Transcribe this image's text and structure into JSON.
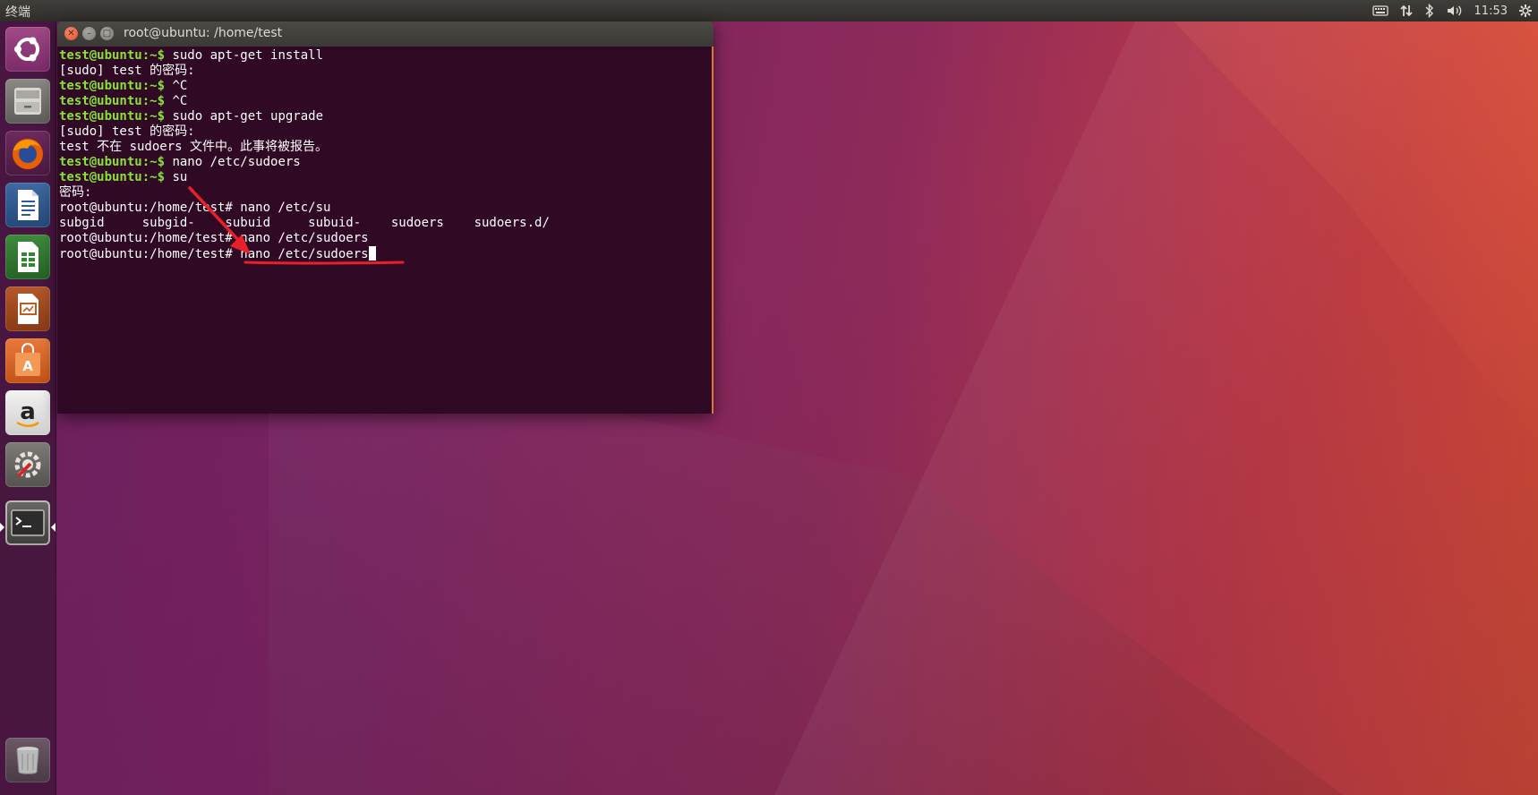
{
  "top_panel": {
    "app_title": "终端",
    "clock": "11:53",
    "indicator_icons": [
      "keyboard-icon",
      "network-icon",
      "bluetooth-icon",
      "volume-icon",
      "gear-icon"
    ]
  },
  "launcher": {
    "items": [
      {
        "name": "ubuntu-dash",
        "icon": "ubuntu-logo-icon"
      },
      {
        "name": "files",
        "icon": "file-cabinet-icon"
      },
      {
        "name": "firefox",
        "icon": "firefox-icon"
      },
      {
        "name": "writer",
        "icon": "document-icon"
      },
      {
        "name": "calc",
        "icon": "spreadsheet-icon"
      },
      {
        "name": "impress",
        "icon": "presentation-icon"
      },
      {
        "name": "software",
        "icon": "shopping-bag-icon"
      },
      {
        "name": "amazon",
        "icon": "amazon-icon"
      },
      {
        "name": "system-settings",
        "icon": "settings-wrench-icon"
      },
      {
        "name": "terminal",
        "icon": "terminal-icon"
      },
      {
        "name": "trash",
        "icon": "trash-icon"
      }
    ]
  },
  "window": {
    "title": "root@ubuntu: /home/test"
  },
  "terminal": {
    "lines": [
      {
        "prompt": "test@ubuntu:~$ ",
        "text": "sudo apt-get install"
      },
      {
        "prompt": "",
        "text": "[sudo] test 的密码:"
      },
      {
        "prompt": "test@ubuntu:~$ ",
        "text": "^C"
      },
      {
        "prompt": "test@ubuntu:~$ ",
        "text": "^C"
      },
      {
        "prompt": "test@ubuntu:~$ ",
        "text": "sudo apt-get upgrade"
      },
      {
        "prompt": "",
        "text": "[sudo] test 的密码:"
      },
      {
        "prompt": "",
        "text": "test 不在 sudoers 文件中。此事将被报告。"
      },
      {
        "prompt": "test@ubuntu:~$ ",
        "text": "nano /etc/sudoers"
      },
      {
        "prompt": "test@ubuntu:~$ ",
        "text": "su"
      },
      {
        "prompt": "",
        "text": "密码:"
      },
      {
        "prompt": "",
        "text": "root@ubuntu:/home/test# nano /etc/su"
      },
      {
        "prompt": "",
        "text": "subgid     subgid-    subuid     subuid-    sudoers    sudoers.d/"
      },
      {
        "prompt": "",
        "text": "root@ubuntu:/home/test# nano /etc/sudoers"
      },
      {
        "prompt": "",
        "text": "root@ubuntu:/home/test# nano /etc/sudoers"
      }
    ]
  },
  "colors": {
    "terminal_bg": "#300a24",
    "prompt_green": "#8ae234",
    "annotation_red": "#e8202a"
  }
}
